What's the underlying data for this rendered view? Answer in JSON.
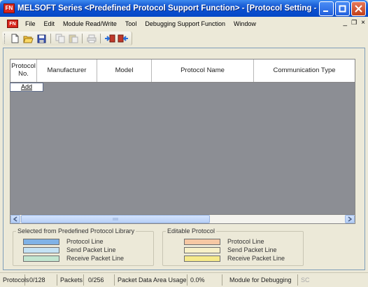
{
  "window": {
    "app_icon_text": "FN",
    "title": "MELSOFT Series <Predefined Protocol Support Function> - [Protocol Setting - Un..."
  },
  "menubar": {
    "doc_icon_text": "FN",
    "items": [
      {
        "label": "File"
      },
      {
        "label": "Edit"
      },
      {
        "label": "Module Read/Write"
      },
      {
        "label": "Tool"
      },
      {
        "label": "Debugging Support Function"
      },
      {
        "label": "Window"
      }
    ],
    "mdi_minimize": "_",
    "mdi_restore": "̅❐",
    "mdi_close": "×"
  },
  "toolbar": {
    "buttons": [
      "new-icon",
      "open-icon",
      "save-icon",
      "copy-icon",
      "paste-icon",
      "print-icon",
      "write-icon",
      "read-icon"
    ]
  },
  "table": {
    "columns": [
      {
        "label": "Protocol\nNo."
      },
      {
        "label": "Manufacturer"
      },
      {
        "label": "Model"
      },
      {
        "label": "Protocol Name"
      },
      {
        "label": "Communication Type"
      }
    ],
    "add_label": "Add"
  },
  "legend_library": {
    "title": "Selected from Predefined Protocol Library",
    "items": [
      {
        "label": "Protocol Line",
        "color": "#7fb2e6"
      },
      {
        "label": "Send Packet Line",
        "color": "#c4e2f4"
      },
      {
        "label": "Receive Packet Line",
        "color": "#c2e6d0"
      }
    ]
  },
  "legend_editable": {
    "title": "Editable Protocol",
    "items": [
      {
        "label": "Protocol Line",
        "color": "#f6c8a4"
      },
      {
        "label": "Send Packet Line",
        "color": "#f7f0c8"
      },
      {
        "label": "Receive Packet Line",
        "color": "#f6ea8a"
      }
    ]
  },
  "statusbar": {
    "protocols_label": "Protocols",
    "protocols_value": "0/128",
    "packets_label": "Packets",
    "packets_value": "0/256",
    "packet_area_label": "Packet Data Area Usage",
    "packet_area_value": "0.0%",
    "mode": "Module for Debugging",
    "trailing": "SC"
  }
}
